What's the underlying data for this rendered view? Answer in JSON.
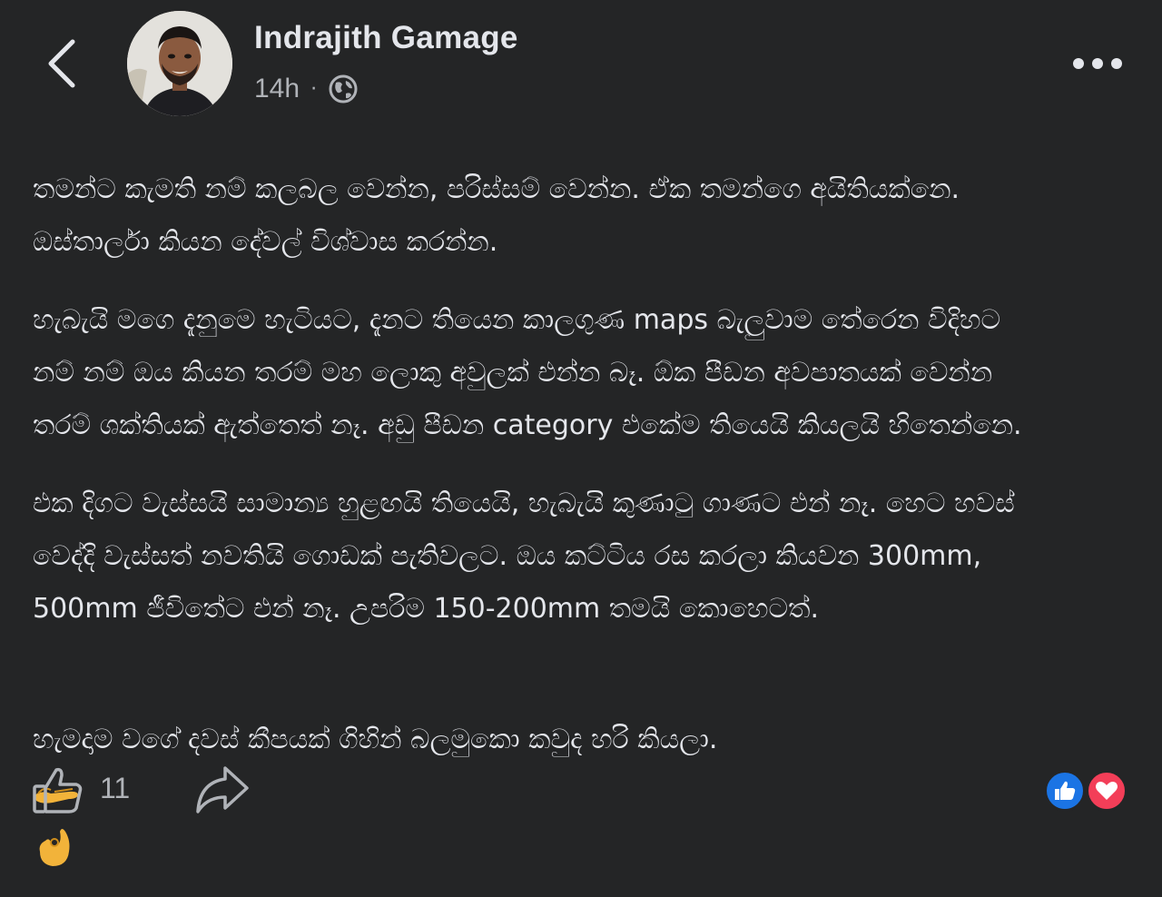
{
  "header": {
    "author_name": "Indrajith Gamage",
    "time": "14h",
    "separator": "·",
    "privacy_icon": "globe-icon",
    "back_icon": "chevron-left-icon",
    "more_icon": "more-dots-icon"
  },
  "post": {
    "paragraphs": [
      "තමන්ට කැමති නම් කලබල වෙන්න, පරිස්සම් වෙන්න. ඒක තමන්ගෙ අයිතියක්නෙ.\nඔස්තාර්ලා කියන දේවල් විශ්වාස කරන්න.",
      "හැබැයි මගෙ දැනුමෙ හැටියට, දැනට තියෙන කාලගුණ maps බැලුවාම තේරෙන විදිහට\nනම් නම් ඔය කියන තරම් මහ ලොකු අවුලක් එන්න බෑ. ඕක පීඩන අවපාතයක් වෙන්න\nතරම් ශක්තියක් ඇත්තෙත් නෑ. අඩු පීඩන category එකේම තියෙයි කියලයි හිතෙන්නෙ.",
      "එක දිගට වැස්සයි සාමාන්‍ය හුළඟයි තියෙයි, හැබැයි කුණාටු ගාණට එන් නෑ. හෙට හවස්\nවෙද්දි වැස්සත් නවතියි ගොඩක් පැතිවලට. ඔය කට්ටිය රස කරලා කියවන 300mm,\n500mm ජීවිතේට එන් නෑ. උපරිම 150-200mm තමයි කොහෙටත්."
    ],
    "last_paragraph": "හැමදාම වගේ දවස් කීපයක් ගිහින් බලමුකො කවුද හරි කියලා.",
    "emojis": [
      "palms-up-hand-emoji",
      "pinching-hand-emoji"
    ]
  },
  "footer": {
    "like_icon": "thumbs-up-icon",
    "like_count": "11",
    "share_icon": "share-arrow-icon",
    "reactions": [
      "like-reaction-icon",
      "love-reaction-icon"
    ]
  },
  "colors": {
    "background": "#242526",
    "text": "#e4e6eb",
    "secondary_text": "#b0b3b8",
    "like_blue": "#1b74e4",
    "love_red": "#f33e58"
  }
}
